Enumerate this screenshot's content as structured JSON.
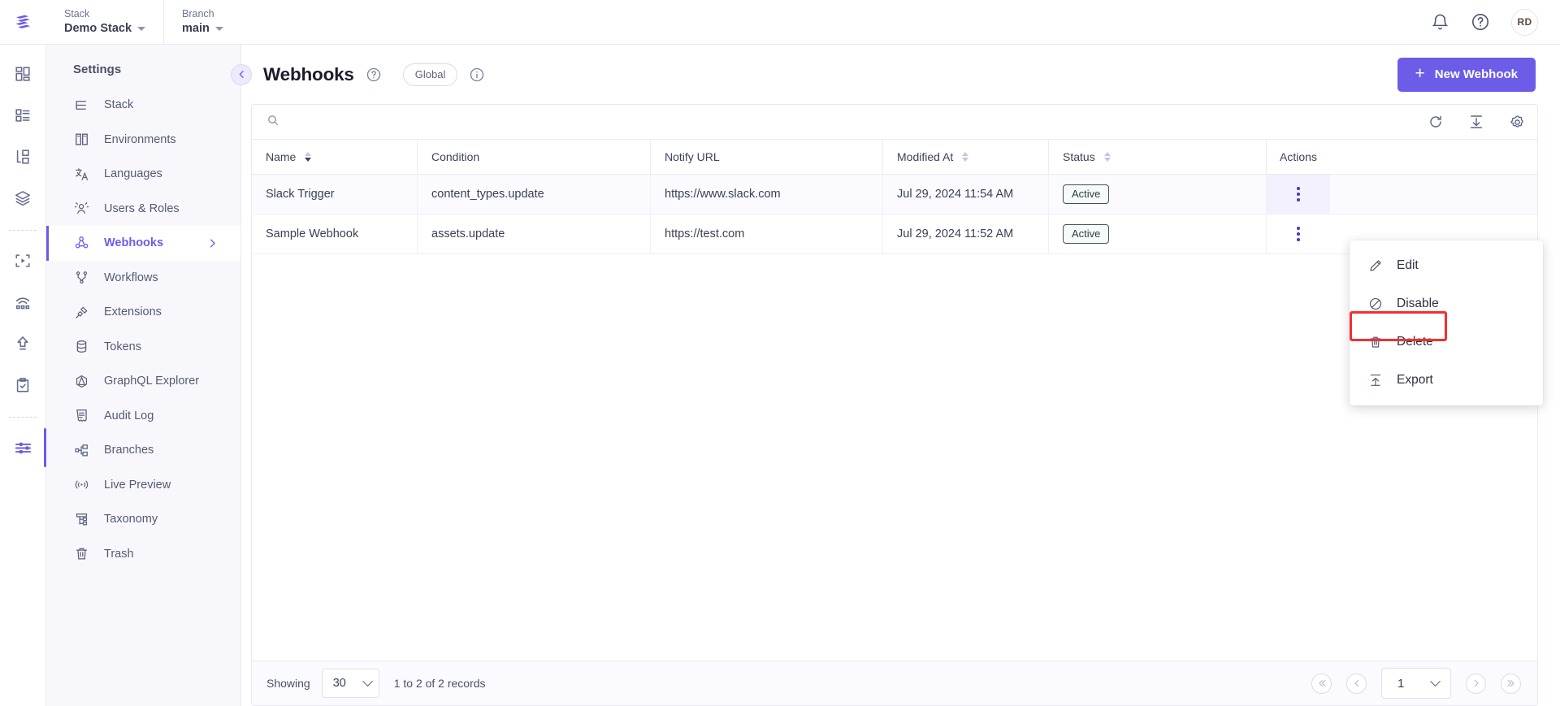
{
  "topbar": {
    "logo_icon": "contentstack-logo",
    "context": [
      {
        "label": "Stack",
        "value": "Demo Stack",
        "name": "stack-selector"
      },
      {
        "label": "Branch",
        "value": "main",
        "name": "branch-selector"
      }
    ],
    "notifications_icon": "bell-icon",
    "help_icon": "question-circle-icon",
    "avatar_initials": "RD"
  },
  "rail": {
    "items": [
      {
        "icon": "dashboard-icon",
        "name": "rail-dashboard"
      },
      {
        "icon": "content-types-icon",
        "name": "rail-content-types"
      },
      {
        "icon": "entries-icon",
        "name": "rail-entries"
      },
      {
        "icon": "assets-stack-icon",
        "name": "rail-assets"
      },
      {
        "icon": "live-preview-icon",
        "name": "rail-live-preview"
      },
      {
        "icon": "releases-icon",
        "name": "rail-releases"
      },
      {
        "icon": "publish-queue-icon",
        "name": "rail-publish-queue"
      },
      {
        "icon": "tasks-icon",
        "name": "rail-tasks"
      },
      {
        "icon": "settings-sliders-icon",
        "name": "rail-settings"
      }
    ]
  },
  "sidebar": {
    "title": "Settings",
    "items": [
      {
        "label": "Stack",
        "icon": "stack-icon",
        "active": false
      },
      {
        "label": "Environments",
        "icon": "environments-icon",
        "active": false
      },
      {
        "label": "Languages",
        "icon": "languages-icon",
        "active": false
      },
      {
        "label": "Users & Roles",
        "icon": "users-roles-icon",
        "active": false
      },
      {
        "label": "Webhooks",
        "icon": "webhooks-icon",
        "active": true
      },
      {
        "label": "Workflows",
        "icon": "workflows-icon",
        "active": false
      },
      {
        "label": "Extensions",
        "icon": "extensions-icon",
        "active": false
      },
      {
        "label": "Tokens",
        "icon": "tokens-icon",
        "active": false
      },
      {
        "label": "GraphQL Explorer",
        "icon": "graphql-icon",
        "active": false
      },
      {
        "label": "Audit Log",
        "icon": "audit-log-icon",
        "active": false
      },
      {
        "label": "Branches",
        "icon": "branches-icon",
        "active": false
      },
      {
        "label": "Live Preview",
        "icon": "live-preview-icon",
        "active": false
      },
      {
        "label": "Taxonomy",
        "icon": "taxonomy-icon",
        "active": false
      },
      {
        "label": "Trash",
        "icon": "trash-icon",
        "active": false
      }
    ]
  },
  "page": {
    "back_icon": "chevron-left-icon",
    "title": "Webhooks",
    "help_icon": "question-circle-icon",
    "scope_pill": "Global",
    "info_icon": "info-circle-icon",
    "new_button": "New Webhook",
    "new_button_icon": "plus-icon",
    "accent_color": "#6c5ce7"
  },
  "toolbar": {
    "search_icon": "search-icon",
    "search_value": "",
    "search_placeholder": "",
    "refresh_icon": "refresh-icon",
    "download_icon": "download-icon",
    "settings_icon": "gear-icon"
  },
  "table": {
    "columns": [
      {
        "label": "Name",
        "sortable": true,
        "sorted": "desc"
      },
      {
        "label": "Condition",
        "sortable": false,
        "sorted": ""
      },
      {
        "label": "Notify URL",
        "sortable": false,
        "sorted": ""
      },
      {
        "label": "Modified At",
        "sortable": true,
        "sorted": ""
      },
      {
        "label": "Status",
        "sortable": true,
        "sorted": ""
      },
      {
        "label": "Actions",
        "sortable": false,
        "sorted": ""
      }
    ],
    "rows": [
      {
        "name": "Slack Trigger",
        "condition": "content_types.update",
        "notify_url": "https://www.slack.com",
        "modified_at": "Jul 29, 2024 11:54 AM",
        "status": "Active"
      },
      {
        "name": "Sample Webhook",
        "condition": "assets.update",
        "notify_url": "https://test.com",
        "modified_at": "Jul 29, 2024 11:52 AM",
        "status": "Active"
      }
    ]
  },
  "footer": {
    "showing_label": "Showing",
    "page_size": "30",
    "records_text": "1 to 2 of 2 records",
    "first_icon": "chevron-double-left-icon",
    "prev_icon": "chevron-left-icon",
    "page_number": "1",
    "next_icon": "chevron-right-icon",
    "last_icon": "chevron-double-right-icon"
  },
  "context_menu": {
    "items": [
      {
        "label": "Edit",
        "icon": "pencil-icon",
        "highlighted": false
      },
      {
        "label": "Disable",
        "icon": "ban-icon",
        "highlighted": false
      },
      {
        "label": "Delete",
        "icon": "trash-icon",
        "highlighted": false
      },
      {
        "label": "Export",
        "icon": "upload-icon",
        "highlighted": true
      }
    ],
    "highlight_color": "#f0322e"
  }
}
